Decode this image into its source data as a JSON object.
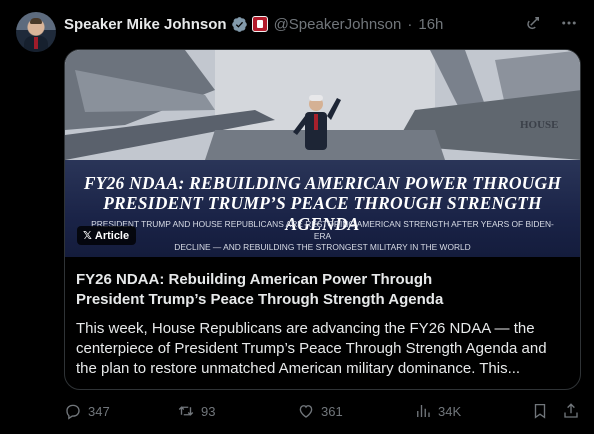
{
  "author": {
    "name": "Speaker Mike Johnson",
    "handle": "@SpeakerJohnson",
    "separator": "·",
    "time": "16h",
    "verified_color": "#829aab",
    "flag_color": "#b31b2b"
  },
  "header_icons": [
    "grok-icon",
    "more-icon"
  ],
  "card": {
    "badge_x": "𝕏",
    "badge_label": "Article",
    "image": {
      "headline_line1": "FY26 NDAA: REBUILDING AMERICAN POWER THROUGH",
      "headline_line2": "PRESIDENT TRUMP’S PEACE THROUGH STRENGTH AGENDA",
      "subline_line1": "PRESIDENT TRUMP AND HOUSE REPUBLICANS ARE RESTORING AMERICAN STRENGTH AFTER YEARS OF BIDEN-ERA",
      "subline_line2": "DECLINE — AND REBUILDING THE STRONGEST MILITARY IN THE WORLD"
    },
    "title_line1": "FY26 NDAA: Rebuilding American Power Through",
    "title_line2": "President Trump’s Peace Through Strength Agenda",
    "desc_line1": "This week, House Republicans are advancing the FY26 NDAA — the",
    "desc_line2": "centerpiece of President Trump’s Peace Through Strength Agenda and",
    "desc_line3": "the plan to restore unmatched American military dominance. This..."
  },
  "actions": {
    "replies": "347",
    "reposts": "93",
    "likes": "361",
    "views": "34K"
  },
  "colors": {
    "background": "#000000",
    "text": "#e7e9ea",
    "muted": "#71767b",
    "border": "#2f3336"
  }
}
